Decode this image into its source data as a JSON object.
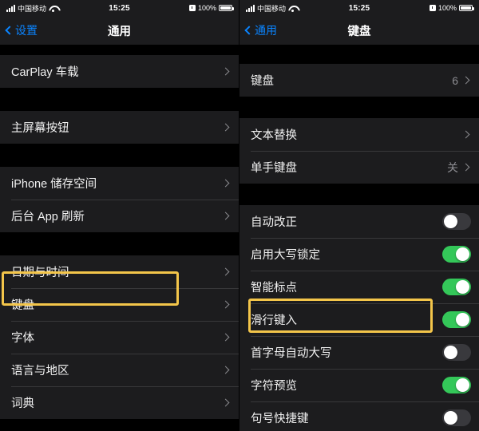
{
  "status_bar": {
    "carrier": "中国移动",
    "time": "15:25",
    "battery_percent": "100%",
    "signal_icon": "signal-bars-icon",
    "wifi_icon": "wifi-icon",
    "alarm_icon": "alarm-clock-icon",
    "battery_icon": "battery-full-icon"
  },
  "colors": {
    "accent_blue": "#0a84ff",
    "toggle_on_green": "#34c759",
    "toggle_off_gray": "#39393d",
    "highlight_yellow": "#f3c54a",
    "row_background": "#1c1c1e",
    "page_background": "#000000",
    "secondary_text": "#8e8e93"
  },
  "left_screen": {
    "nav": {
      "back_label": "设置",
      "title": "通用"
    },
    "sections": [
      {
        "rows": [
          {
            "label": "CarPlay 车载",
            "accessory": "chevron"
          }
        ]
      },
      {
        "rows": [
          {
            "label": "主屏幕按钮",
            "accessory": "chevron"
          }
        ]
      },
      {
        "rows": [
          {
            "label": "iPhone 储存空间",
            "accessory": "chevron"
          },
          {
            "label": "后台 App 刷新",
            "accessory": "chevron"
          }
        ]
      },
      {
        "rows": [
          {
            "label": "日期与时间",
            "accessory": "chevron"
          },
          {
            "label": "键盘",
            "accessory": "chevron",
            "highlighted": true
          },
          {
            "label": "字体",
            "accessory": "chevron"
          },
          {
            "label": "语言与地区",
            "accessory": "chevron"
          },
          {
            "label": "词典",
            "accessory": "chevron"
          }
        ]
      }
    ]
  },
  "right_screen": {
    "nav": {
      "back_label": "通用",
      "title": "键盘"
    },
    "sections": [
      {
        "rows": [
          {
            "label": "键盘",
            "value": "6",
            "accessory": "chevron"
          }
        ]
      },
      {
        "rows": [
          {
            "label": "文本替换",
            "accessory": "chevron"
          },
          {
            "label": "单手键盘",
            "value": "关",
            "accessory": "chevron"
          }
        ]
      },
      {
        "rows": [
          {
            "label": "自动改正",
            "accessory": "toggle",
            "on": false
          },
          {
            "label": "启用大写锁定",
            "accessory": "toggle",
            "on": true
          },
          {
            "label": "智能标点",
            "accessory": "toggle",
            "on": true
          },
          {
            "label": "滑行键入",
            "accessory": "toggle",
            "on": true,
            "highlighted": true
          },
          {
            "label": "首字母自动大写",
            "accessory": "toggle",
            "on": false
          },
          {
            "label": "字符预览",
            "accessory": "toggle",
            "on": true
          },
          {
            "label": "句号快捷键",
            "accessory": "toggle",
            "on": false
          }
        ]
      }
    ]
  }
}
